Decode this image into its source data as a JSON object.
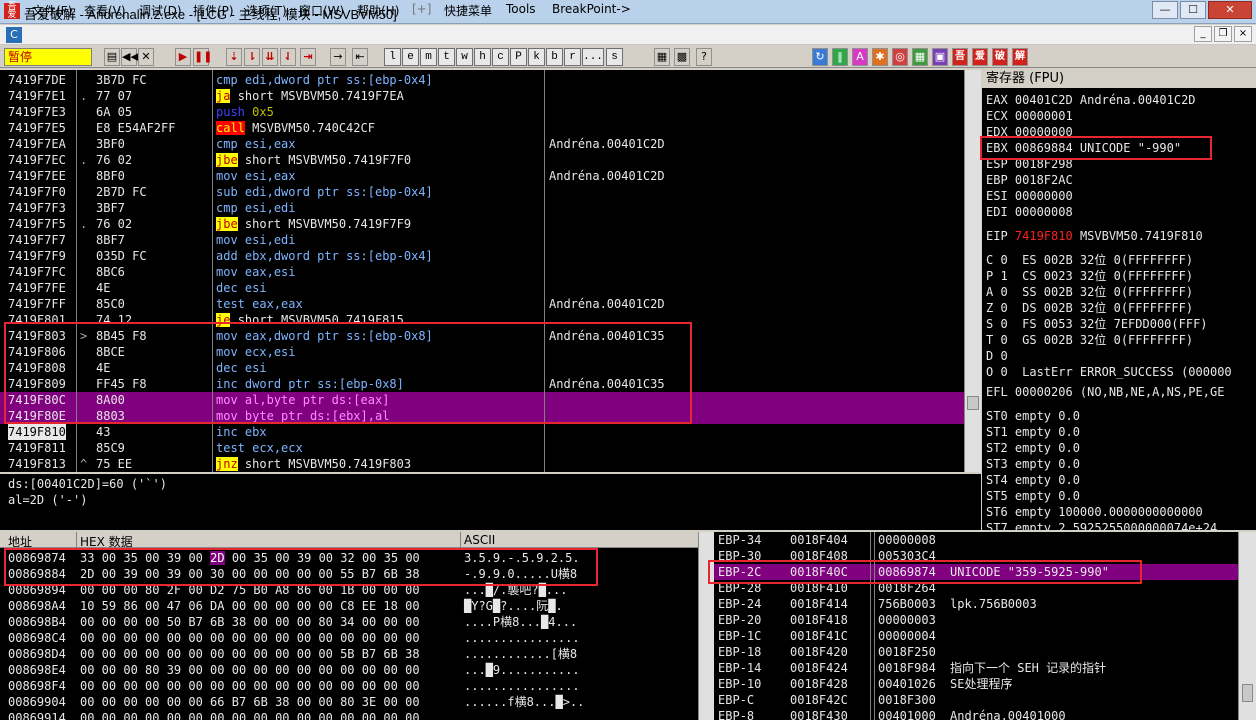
{
  "window": {
    "title": "吾爱破解 - Andrénalin.2.exe - [LCG - 主线程, 模块 - MSVBVM50]",
    "icon_text": "吾爱"
  },
  "window_buttons": {
    "minimize": "—",
    "maximize": "☐",
    "close": "✕"
  },
  "menu": [
    {
      "label": "文件(F)"
    },
    {
      "label": "查看(V)"
    },
    {
      "label": "调试(D)"
    },
    {
      "label": "插件(P)"
    },
    {
      "label": "选项(T)"
    },
    {
      "label": "窗口(W)"
    },
    {
      "label": "帮助(H)"
    },
    {
      "label": "[+]"
    },
    {
      "label": "快捷菜单"
    },
    {
      "label": "Tools"
    },
    {
      "label": "BreakPoint->"
    }
  ],
  "mdi_buttons": {
    "minimize": "_",
    "restore": "❐",
    "close": "×"
  },
  "toolbar": {
    "status": "暂停",
    "letters": [
      "l",
      "e",
      "m",
      "t",
      "w",
      "h",
      "c",
      "P",
      "k",
      "b",
      "r",
      "...",
      "s"
    ],
    "badges": [
      "吾",
      "爱",
      "破",
      "解"
    ]
  },
  "disasm": [
    {
      "addr": "7419F7DE",
      "arrow": "",
      "hex": "3B7D FC",
      "mn": "cmp",
      "ops": "edi,dword ptr ss:[ebp-0x4]",
      "cmt": ""
    },
    {
      "addr": "7419F7E1",
      "arrow": ".",
      "hex": "77 07",
      "mn": "ja",
      "ops": "short MSVBVM50.7419F7EA",
      "cmt": ""
    },
    {
      "addr": "7419F7E3",
      "arrow": "",
      "hex": "6A 05",
      "mn": "push",
      "ops": "0x5",
      "cmt": ""
    },
    {
      "addr": "7419F7E5",
      "arrow": "",
      "hex": "E8 E54AF2FF",
      "mn": "call",
      "ops": "MSVBVM50.740C42CF",
      "cmt": ""
    },
    {
      "addr": "7419F7EA",
      "arrow": "",
      "hex": "3BF0",
      "mn": "cmp",
      "ops": "esi,eax",
      "cmt": "Andréna.00401C2D"
    },
    {
      "addr": "7419F7EC",
      "arrow": ".",
      "hex": "76 02",
      "mn": "jbe",
      "ops": "short MSVBVM50.7419F7F0",
      "cmt": ""
    },
    {
      "addr": "7419F7EE",
      "arrow": "",
      "hex": "8BF0",
      "mn": "mov",
      "ops": "esi,eax",
      "cmt": "Andréna.00401C2D"
    },
    {
      "addr": "7419F7F0",
      "arrow": "",
      "hex": "2B7D FC",
      "mn": "sub",
      "ops": "edi,dword ptr ss:[ebp-0x4]",
      "cmt": ""
    },
    {
      "addr": "7419F7F3",
      "arrow": "",
      "hex": "3BF7",
      "mn": "cmp",
      "ops": "esi,edi",
      "cmt": ""
    },
    {
      "addr": "7419F7F5",
      "arrow": ".",
      "hex": "76 02",
      "mn": "jbe",
      "ops": "short MSVBVM50.7419F7F9",
      "cmt": ""
    },
    {
      "addr": "7419F7F7",
      "arrow": "",
      "hex": "8BF7",
      "mn": "mov",
      "ops": "esi,edi",
      "cmt": ""
    },
    {
      "addr": "7419F7F9",
      "arrow": "",
      "hex": "035D FC",
      "mn": "add",
      "ops": "ebx,dword ptr ss:[ebp-0x4]",
      "cmt": ""
    },
    {
      "addr": "7419F7FC",
      "arrow": "",
      "hex": "8BC6",
      "mn": "mov",
      "ops": "eax,esi",
      "cmt": ""
    },
    {
      "addr": "7419F7FE",
      "arrow": "",
      "hex": "4E",
      "mn": "dec",
      "ops": "esi",
      "cmt": ""
    },
    {
      "addr": "7419F7FF",
      "arrow": "",
      "hex": "85C0",
      "mn": "test",
      "ops": "eax,eax",
      "cmt": "Andréna.00401C2D"
    },
    {
      "addr": "7419F801",
      "arrow": ".",
      "hex": "74 12",
      "mn": "je",
      "ops": "short MSVBVM50.7419F815",
      "cmt": ""
    },
    {
      "addr": "7419F803",
      "arrow": ">",
      "hex": "8B45 F8",
      "mn": "mov",
      "ops": "eax,dword ptr ss:[ebp-0x8]",
      "cmt": "Andréna.00401C35"
    },
    {
      "addr": "7419F806",
      "arrow": "",
      "hex": "8BCE",
      "mn": "mov",
      "ops": "ecx,esi",
      "cmt": ""
    },
    {
      "addr": "7419F808",
      "arrow": "",
      "hex": "4E",
      "mn": "dec",
      "ops": "esi",
      "cmt": ""
    },
    {
      "addr": "7419F809",
      "arrow": "",
      "hex": "FF45 F8",
      "mn": "inc",
      "ops": "dword ptr ss:[ebp-0x8]",
      "cmt": "Andréna.00401C35"
    },
    {
      "addr": "7419F80C",
      "arrow": "",
      "hex": "8A00",
      "mn": "mov",
      "ops": "al,byte ptr ds:[eax]",
      "cmt": ""
    },
    {
      "addr": "7419F80E",
      "arrow": "",
      "hex": "8803",
      "mn": "mov",
      "ops": "byte ptr ds:[ebx],al",
      "cmt": ""
    },
    {
      "addr": "7419F810",
      "arrow": "",
      "hex": "43",
      "mn": "inc",
      "ops": "ebx",
      "cmt": ""
    },
    {
      "addr": "7419F811",
      "arrow": "",
      "hex": "85C9",
      "mn": "test",
      "ops": "ecx,ecx",
      "cmt": ""
    },
    {
      "addr": "7419F813",
      "arrow": "^",
      "hex": "75 EE",
      "mn": "jnz",
      "ops": "short MSVBVM50.7419F803",
      "cmt": ""
    }
  ],
  "info": {
    "line1": "ds:[00401C2D]=60 ('`')",
    "line2": "al=2D ('-')"
  },
  "registers": {
    "header": "寄存器 (FPU)",
    "gpr": [
      "EAX 00401C2D Andréna.00401C2D",
      "ECX 00000001",
      "EDX 00000000",
      "EBX 00869884 UNICODE \"-990\"",
      "ESP 0018F298",
      "EBP 0018F2AC",
      "ESI 00000000",
      "EDI 00000008"
    ],
    "eip": {
      "label": "EIP",
      "value": "7419F810",
      "symbol": "MSVBVM50.7419F810"
    },
    "flags": [
      "C 0  ES 002B 32位 0(FFFFFFFF)",
      "P 1  CS 0023 32位 0(FFFFFFFF)",
      "A 0  SS 002B 32位 0(FFFFFFFF)",
      "Z 0  DS 002B 32位 0(FFFFFFFF)",
      "S 0  FS 0053 32位 7EFDD000(FFF)",
      "T 0  GS 002B 32位 0(FFFFFFFF)",
      "D 0",
      "O 0  LastErr ERROR_SUCCESS (000000"
    ],
    "efl": "EFL 00000206 (NO,NB,NE,A,NS,PE,GE",
    "fpu": [
      "ST0 empty 0.0",
      "ST1 empty 0.0",
      "ST2 empty 0.0",
      "ST3 empty 0.0",
      "ST4 empty 0.0",
      "ST5 empty 0.0",
      "ST6 empty 100000.0000000000000",
      "ST7 empty 2.5925255000000074e+24"
    ]
  },
  "dump": {
    "headers": {
      "address": "地址",
      "hex": "HEX 数据",
      "ascii": "ASCII"
    },
    "rows": [
      {
        "addr": "00869874",
        "hex": "33 00 35 00 39 00 2D 00 35 00 39 00 32 00 35 00",
        "ascii": "3.5.9.-.5.9.2.5."
      },
      {
        "addr": "00869884",
        "hex": "2D 00 39 00 39 00 30 00 00 00 00 00 55 B7 6B 38",
        "ascii": "-.9.9.0.....U横8"
      },
      {
        "addr": "00869894",
        "hex": "00 00 00 80 2F 00 D2 75 B0 A8 86 00 1B 00 00 00",
        "ascii": "...█/.襲吧?█..."
      },
      {
        "addr": "008698A4",
        "hex": "10 59 86 00 47 06 DA 00 00 00 00 00 C8 EE 18 00",
        "ascii": "█Y?G█?....阮█."
      },
      {
        "addr": "008698B4",
        "hex": "00 00 00 00 50 B7 6B 38 00 00 00 80 34 00 00 00",
        "ascii": "....P横8...█4..."
      },
      {
        "addr": "008698C4",
        "hex": "00 00 00 00 00 00 00 00 00 00 00 00 00 00 00 00",
        "ascii": "................"
      },
      {
        "addr": "008698D4",
        "hex": "00 00 00 00 00 00 00 00 00 00 00 00 5B B7 6B 38",
        "ascii": "............[横8"
      },
      {
        "addr": "008698E4",
        "hex": "00 00 00 80 39 00 00 00 00 00 00 00 00 00 00 00",
        "ascii": "...█9..........."
      },
      {
        "addr": "008698F4",
        "hex": "00 00 00 00 00 00 00 00 00 00 00 00 00 00 00 00",
        "ascii": "................"
      },
      {
        "addr": "00869904",
        "hex": "00 00 00 00 00 00 66 B7 6B 38 00 00 80 3E 00 00",
        "ascii": "......f横8...█>.."
      },
      {
        "addr": "00869914",
        "hex": "00 00 00 00 00 00 00 00 00 00 00 00 00 00 00 00",
        "ascii": "................"
      }
    ]
  },
  "stack": [
    {
      "off": "EBP-34",
      "addr": "0018F404",
      "val": "00000008",
      "cmt": ""
    },
    {
      "off": "EBP-30",
      "addr": "0018F408",
      "val": "005303C4",
      "cmt": ""
    },
    {
      "off": "EBP-2C",
      "addr": "0018F40C",
      "val": "00869874",
      "cmt": "UNICODE \"359-5925-990\""
    },
    {
      "off": "EBP-28",
      "addr": "0018F410",
      "val": "0018F264",
      "cmt": ""
    },
    {
      "off": "EBP-24",
      "addr": "0018F414",
      "val": "756B0003",
      "cmt": "lpk.756B0003"
    },
    {
      "off": "EBP-20",
      "addr": "0018F418",
      "val": "00000003",
      "cmt": ""
    },
    {
      "off": "EBP-1C",
      "addr": "0018F41C",
      "val": "00000004",
      "cmt": ""
    },
    {
      "off": "EBP-18",
      "addr": "0018F420",
      "val": "0018F250",
      "cmt": ""
    },
    {
      "off": "EBP-14",
      "addr": "0018F424",
      "val": "0018F984",
      "cmt": "指向下一个 SEH 记录的指针"
    },
    {
      "off": "EBP-10",
      "addr": "0018F428",
      "val": "00401026",
      "cmt": "SE处理程序"
    },
    {
      "off": "EBP-C",
      "addr": "0018F42C",
      "val": "0018F300",
      "cmt": ""
    },
    {
      "off": "EBP-8",
      "addr": "0018F430",
      "val": "00401000",
      "cmt": "Andréna.00401000"
    }
  ],
  "colors": {
    "selection": "#800080",
    "highlight_box": "#e8262f",
    "eip_text": "#ff2020",
    "jump_bg": "#ffff00",
    "call_bg": "#ff0000"
  }
}
